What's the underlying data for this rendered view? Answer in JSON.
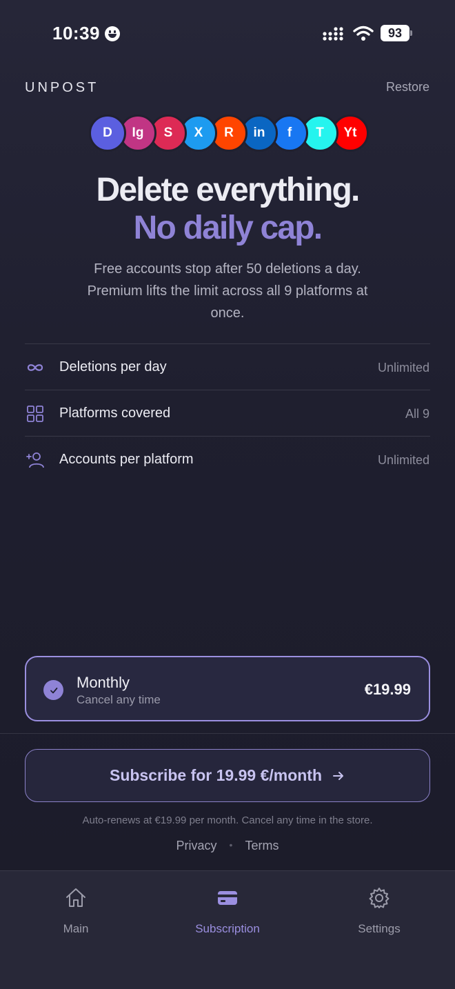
{
  "status_bar": {
    "time": "10:39",
    "battery": "93"
  },
  "header": {
    "brand": "UNPOST",
    "restore_label": "Restore"
  },
  "platforms": [
    {
      "label": "D",
      "color": "#5b5fe0"
    },
    {
      "label": "Ig",
      "color": "#c13584"
    },
    {
      "label": "S",
      "color": "#dd2a55"
    },
    {
      "label": "X",
      "color": "#1d9bf0"
    },
    {
      "label": "R",
      "color": "#ff4500"
    },
    {
      "label": "in",
      "color": "#0a66c2"
    },
    {
      "label": "f",
      "color": "#1877f2"
    },
    {
      "label": "T",
      "color": "#25f4ee"
    },
    {
      "label": "Yt",
      "color": "#ff0000"
    }
  ],
  "hero": {
    "line1": "Delete everything.",
    "line2": "No daily cap.",
    "subtitle": "Free accounts stop after 50 deletions a day. Premium lifts the limit across all 9 platforms at once."
  },
  "features": [
    {
      "icon": "infinity-icon",
      "label": "Deletions per day",
      "value": "Unlimited"
    },
    {
      "icon": "grid-icon",
      "label": "Platforms covered",
      "value": "All 9"
    },
    {
      "icon": "add-user-icon",
      "label": "Accounts per platform",
      "value": "Unlimited"
    }
  ],
  "plan": {
    "name": "Monthly",
    "note": "Cancel any time",
    "price": "€19.99",
    "selected": true
  },
  "subscribe": {
    "label": "Subscribe for 19.99 €/month"
  },
  "footer": {
    "renew_note": "Auto-renews at €19.99 per month. Cancel any time in the store.",
    "privacy": "Privacy",
    "terms": "Terms",
    "separator": "•"
  },
  "tabs": [
    {
      "label": "Main",
      "icon": "home-icon",
      "active": false
    },
    {
      "label": "Subscription",
      "icon": "card-icon",
      "active": true
    },
    {
      "label": "Settings",
      "icon": "gear-icon",
      "active": false
    }
  ],
  "colors": {
    "accent": "#8f83d6",
    "background": "#1f1f2f"
  }
}
